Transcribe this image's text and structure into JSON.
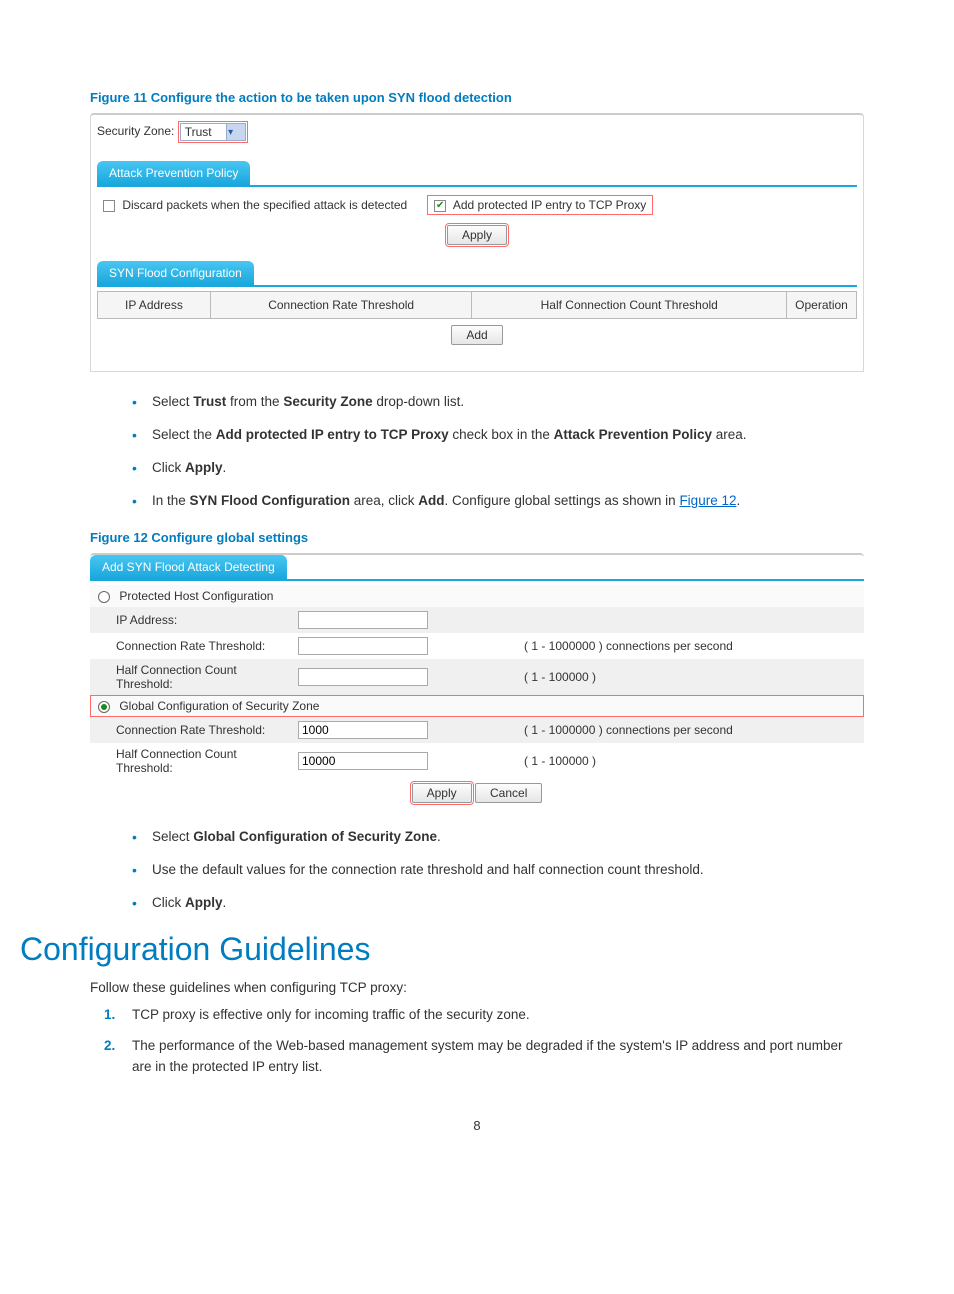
{
  "figure11": {
    "caption": "Figure 11 Configure the action to be taken upon SYN flood detection",
    "security_zone_label": "Security Zone:",
    "security_zone_value": "Trust",
    "policy_tab": "Attack Prevention Policy",
    "discard_label": "Discard packets when the specified attack is detected",
    "proxy_label": "Add protected IP entry to TCP Proxy",
    "apply_label": "Apply",
    "syn_tab": "SYN Flood Configuration",
    "cols": {
      "ip": "IP Address",
      "rate": "Connection Rate Threshold",
      "half": "Half Connection Count Threshold",
      "op": "Operation"
    },
    "add_label": "Add"
  },
  "bullets1": {
    "b1a": "Select ",
    "b1b": "Trust",
    "b1c": " from the ",
    "b1d": "Security Zone",
    "b1e": " drop-down list.",
    "b2a": "Select the ",
    "b2b": "Add protected IP entry to TCP Proxy",
    "b2c": " check box in the ",
    "b2d": "Attack Prevention Policy",
    "b2e": " area.",
    "b3a": "Click ",
    "b3b": "Apply",
    "b3c": ".",
    "b4a": "In the ",
    "b4b": "SYN Flood Configuration",
    "b4c": " area, click ",
    "b4d": "Add",
    "b4e": ". Configure global settings as shown in ",
    "b4f": "Figure 12",
    "b4g": "."
  },
  "figure12": {
    "caption": "Figure 12 Configure global settings",
    "tab": "Add SYN Flood Attack Detecting",
    "radio1": "Protected Host Configuration",
    "ip_label": "IP Address:",
    "rate_label": "Connection Rate Threshold:",
    "rate_hint": "( 1 - 1000000 ) connections per second",
    "half_label": "Half Connection Count Threshold:",
    "half_hint": "( 1 - 100000 )",
    "radio2": "Global Configuration of Security Zone",
    "rate_value": "1000",
    "half_value": "10000",
    "apply": "Apply",
    "cancel": "Cancel"
  },
  "bullets2": {
    "b1a": "Select ",
    "b1b": "Global Configuration of Security Zone",
    "b1c": ".",
    "b2": "Use the default values for the connection rate threshold and half connection count threshold.",
    "b3a": "Click ",
    "b3b": "Apply",
    "b3c": "."
  },
  "guidelines": {
    "heading": "Configuration Guidelines",
    "intro": "Follow these guidelines when configuring TCP proxy:",
    "n1": "1.",
    "t1": "TCP proxy is effective only for incoming traffic of the security zone.",
    "n2": "2.",
    "t2": "The performance of the Web-based management system may be degraded if the system's IP address and port number are in the protected IP entry list."
  },
  "page_number": "8"
}
